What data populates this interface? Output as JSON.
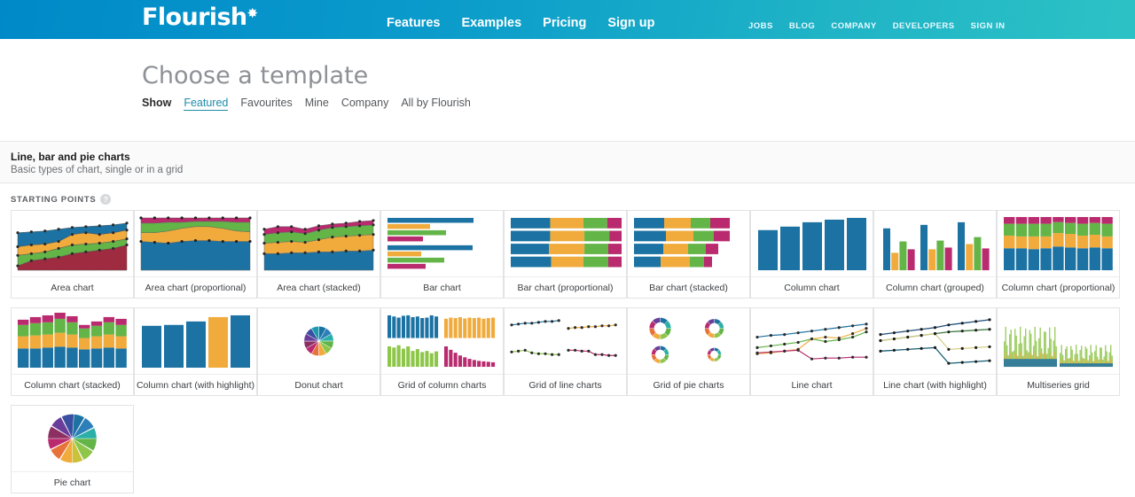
{
  "topbar": {
    "logo_text": "Flourish",
    "logo_star": "✸",
    "main_nav": [
      {
        "label": "Features"
      },
      {
        "label": "Examples"
      },
      {
        "label": "Pricing"
      },
      {
        "label": "Sign up"
      }
    ],
    "sub_nav": [
      {
        "label": "JOBS"
      },
      {
        "label": "BLOG"
      },
      {
        "label": "COMPANY"
      },
      {
        "label": "DEVELOPERS"
      },
      {
        "label": "SIGN IN"
      }
    ],
    "gradient_start": "#0089c8",
    "gradient_end": "#2cc2c5"
  },
  "page": {
    "title": "Choose a template",
    "filter_label": "Show",
    "filters": [
      {
        "label": "Featured",
        "active": true
      },
      {
        "label": "Favourites",
        "active": false
      },
      {
        "label": "Mine",
        "active": false
      },
      {
        "label": "Company",
        "active": false
      },
      {
        "label": "All by Flourish",
        "active": false
      }
    ]
  },
  "section": {
    "title": "Line, bar and pie charts",
    "subtitle": "Basic types of chart, single or in a grid",
    "starting_points_label": "STARTING POINTS",
    "help_icon_text": "?"
  },
  "palette": {
    "blue": "#1b72a3",
    "orange": "#f0ab3c",
    "green": "#63b548",
    "magenta": "#b92a6e",
    "teal": "#2ab0a6",
    "purple": "#6a3d9a",
    "red": "#9e2b3f",
    "lightgreen": "#8ec64a"
  },
  "templates": [
    {
      "label": "Area chart",
      "thumb": "area"
    },
    {
      "label": "Area chart (proportional)",
      "thumb": "area-proportional"
    },
    {
      "label": "Area chart (stacked)",
      "thumb": "area-stacked"
    },
    {
      "label": "Bar chart",
      "thumb": "bar"
    },
    {
      "label": "Bar chart (proportional)",
      "thumb": "bar-proportional"
    },
    {
      "label": "Bar chart (stacked)",
      "thumb": "bar-stacked"
    },
    {
      "label": "Column chart",
      "thumb": "column"
    },
    {
      "label": "Column chart (grouped)",
      "thumb": "column-grouped"
    },
    {
      "label": "Column chart (proportional)",
      "thumb": "column-proportional"
    },
    {
      "label": "Column chart (stacked)",
      "thumb": "column-stacked"
    },
    {
      "label": "Column chart (with highlight)",
      "thumb": "column-highlight"
    },
    {
      "label": "Donut chart",
      "thumb": "donut"
    },
    {
      "label": "Grid of column charts",
      "thumb": "grid-column"
    },
    {
      "label": "Grid of line charts",
      "thumb": "grid-line"
    },
    {
      "label": "Grid of pie charts",
      "thumb": "grid-pie"
    },
    {
      "label": "Line chart",
      "thumb": "line"
    },
    {
      "label": "Line chart (with highlight)",
      "thumb": "line-highlight"
    },
    {
      "label": "Multiseries grid",
      "thumb": "multiseries"
    },
    {
      "label": "Pie chart",
      "thumb": "pie"
    }
  ]
}
